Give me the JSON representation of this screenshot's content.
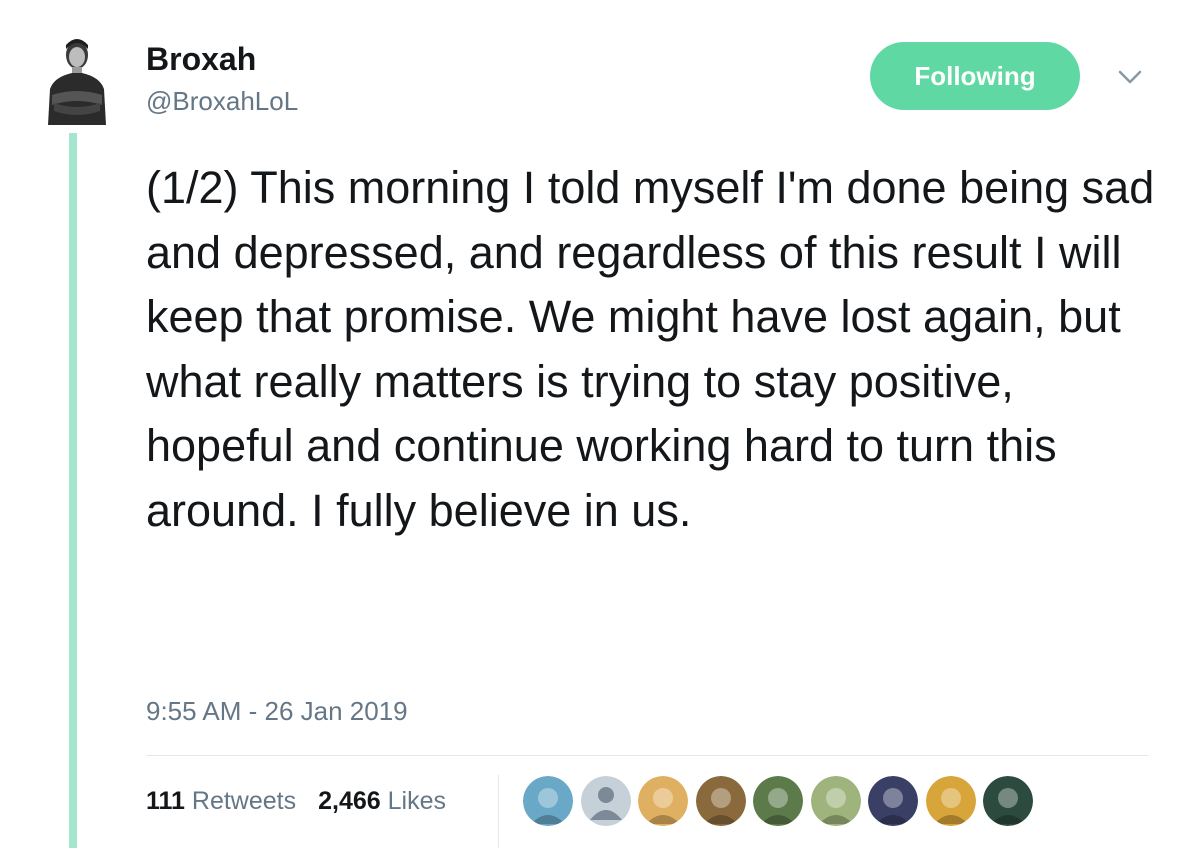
{
  "author": {
    "name": "Broxah",
    "handle": "@BroxahLoL"
  },
  "follow_button": {
    "label": "Following",
    "color": "#5fd8a4"
  },
  "menu": {
    "icon": "chevron-down-icon"
  },
  "tweet": {
    "text": "(1/2) This morning I told myself I'm done being sad and depressed, and regardless of this result I will keep that promise. We might have lost again, but what really matters is trying to stay positive, hopeful and continue working hard to turn this around.  I fully believe in us.",
    "timestamp": "9:55 AM - 26 Jan 2019"
  },
  "stats": {
    "retweets_count": "111",
    "retweets_label": "Retweets",
    "likes_count": "2,466",
    "likes_label": "Likes"
  },
  "likers": [
    {
      "icon": "liker-avatar-1",
      "color": "#6aa8c8"
    },
    {
      "icon": "default-user-avatar",
      "color": "#c5d0d8"
    },
    {
      "icon": "liker-avatar-3",
      "color": "#e0b062"
    },
    {
      "icon": "liker-avatar-4",
      "color": "#8a6a3c"
    },
    {
      "icon": "liker-avatar-5",
      "color": "#5c7a4a"
    },
    {
      "icon": "liker-avatar-6",
      "color": "#9fb47c"
    },
    {
      "icon": "liker-avatar-7",
      "color": "#3a3f66"
    },
    {
      "icon": "liker-avatar-8",
      "color": "#d8a53a"
    },
    {
      "icon": "liker-avatar-9",
      "color": "#2c4a3e"
    }
  ],
  "colors": {
    "thread_line": "#a3e6cd",
    "secondary_text": "#657786",
    "primary_text": "#14171a"
  }
}
